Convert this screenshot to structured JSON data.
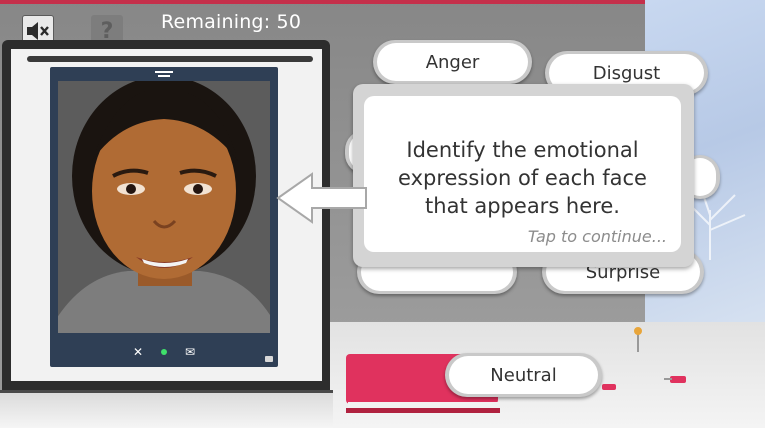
{
  "hud": {
    "remaining_label": "Remaining: 50"
  },
  "icons": {
    "mute": "speaker-muted-icon",
    "help": "question-mark-icon",
    "help_glyph": "?"
  },
  "options": {
    "anger": "Anger",
    "disgust": "Disgust",
    "surprise": "Surprise",
    "neutral": "Neutral"
  },
  "instruction": {
    "line1": "Identify the emotional",
    "line2": "expression of each face",
    "line3": "that appears here.",
    "hint": "Tap to continue..."
  },
  "phone": {
    "close_glyph": "✕",
    "mail_glyph": "✉"
  },
  "colors": {
    "accent_strip": "#c5304b",
    "status_green": "#3fe06b",
    "phone_frame": "#2f3f55"
  }
}
